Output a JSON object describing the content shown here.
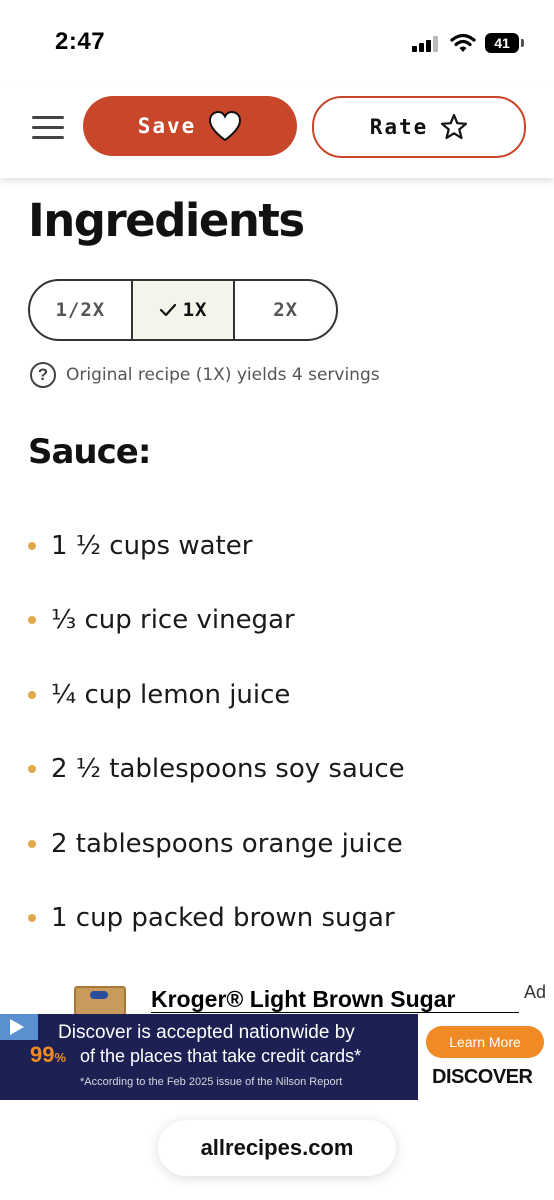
{
  "status_bar": {
    "time": "2:47",
    "battery": "41"
  },
  "header": {
    "save_label": "Save",
    "rate_label": "Rate",
    "accent_color": "#c8472a"
  },
  "main": {
    "heading": "Ingredients",
    "scale_options": [
      "1/2X",
      "1X",
      "2X"
    ],
    "selected_scale": "1X",
    "yield_text": "Original recipe (1X) yields 4 servings",
    "section_title": "Sauce:",
    "ingredients": [
      "1 ½ cups water",
      "⅓ cup rice vinegar",
      "¼ cup lemon juice",
      "2 ½ tablespoons soy sauce",
      "2 tablespoons orange juice",
      "1 cup packed brown sugar"
    ]
  },
  "product": {
    "title": "Kroger® Light Brown Sugar",
    "ad_label": "Ad"
  },
  "ad_banner": {
    "line1": "Discover is accepted nationwide by",
    "percent": "99",
    "percent_sign": "%",
    "line2": "of the places that take credit cards*",
    "footnote": "*According to the Feb 2025 issue of the Nilson Report",
    "cta": "Learn More",
    "brand": "DISCOVER"
  },
  "browser": {
    "url": "allrecipes.com"
  }
}
